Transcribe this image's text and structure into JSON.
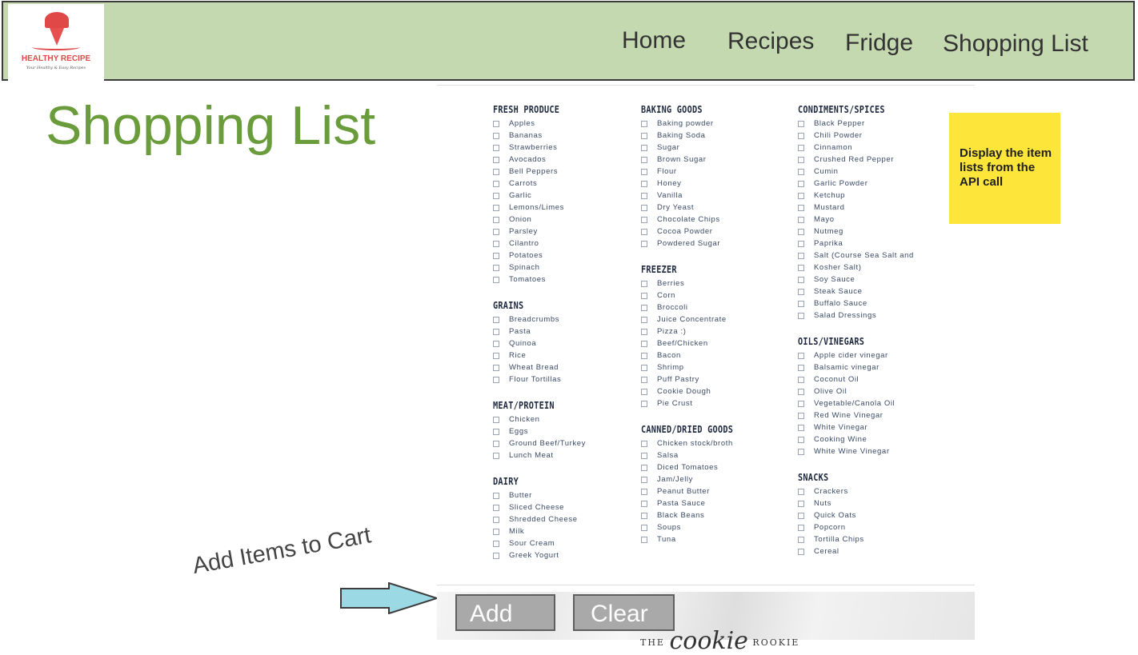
{
  "header": {
    "logo": {
      "brand": "HEALTHY RECIPE",
      "tagline": "Your Healthy & Easy Recipes"
    },
    "nav": [
      "Home",
      "Recipes",
      "Fridge",
      "Shopping List"
    ]
  },
  "page_title": "Shopping List",
  "note": "Display the item lists from the API call",
  "annotation": "Add Items to Cart",
  "buttons": {
    "add": "Add",
    "clear": "Clear"
  },
  "footer_brand": {
    "the": "THE",
    "script": "cookie",
    "rookie": "ROOKIE"
  },
  "columns": [
    [
      {
        "title": "FRESH PRODUCE",
        "items": [
          "Apples",
          "Bananas",
          "Strawberries",
          "Avocados",
          "Bell Peppers",
          "Carrots",
          "Garlic",
          "Lemons/Limes",
          "Onion",
          "Parsley",
          "Cilantro",
          "Potatoes",
          "Spinach",
          "Tomatoes"
        ]
      },
      {
        "title": "GRAINS",
        "items": [
          "Breadcrumbs",
          "Pasta",
          "Quinoa",
          "Rice",
          "Wheat Bread",
          "Flour Tortillas"
        ]
      },
      {
        "title": "MEAT/PROTEIN",
        "items": [
          "Chicken",
          "Eggs",
          "Ground Beef/Turkey",
          "Lunch Meat"
        ]
      },
      {
        "title": "DAIRY",
        "items": [
          "Butter",
          "Sliced Cheese",
          "Shredded Cheese",
          "Milk",
          "Sour Cream",
          "Greek Yogurt"
        ]
      }
    ],
    [
      {
        "title": "BAKING GOODS",
        "items": [
          "Baking powder",
          "Baking Soda",
          "Sugar",
          "Brown Sugar",
          "Flour",
          "Honey",
          "Vanilla",
          "Dry Yeast",
          "Chocolate Chips",
          "Cocoa Powder",
          "Powdered Sugar"
        ]
      },
      {
        "title": "FREEZER",
        "items": [
          "Berries",
          "Corn",
          "Broccoli",
          "Juice Concentrate",
          "Pizza :)",
          "Beef/Chicken",
          "Bacon",
          "Shrimp",
          "Puff Pastry",
          "Cookie Dough",
          "Pie Crust"
        ]
      },
      {
        "title": "CANNED/DRIED GOODS",
        "items": [
          "Chicken stock/broth",
          "Salsa",
          "Diced Tomatoes",
          "Jam/Jelly",
          "Peanut Butter",
          "Pasta Sauce",
          "Black Beans",
          "Soups",
          "Tuna"
        ]
      }
    ],
    [
      {
        "title": "CONDIMENTS/SPICES",
        "items": [
          "Black Pepper",
          "Chili Powder",
          "Cinnamon",
          "Crushed Red Pepper",
          "Cumin",
          "Garlic Powder",
          "Ketchup",
          "Mustard",
          "Mayo",
          "Nutmeg",
          "Paprika",
          "Salt (Course Sea Salt and",
          "Kosher Salt)",
          "Soy Sauce",
          "Steak Sauce",
          "Buffalo Sauce",
          "Salad Dressings"
        ]
      },
      {
        "title": "OILS/VINEGARS",
        "items": [
          "Apple cider vinegar",
          "Balsamic vinegar",
          "Coconut Oil",
          "Olive Oil",
          "Vegetable/Canola Oil",
          "Red Wine Vinegar",
          "White Vinegar",
          "Cooking Wine",
          "White Wine Vinegar"
        ]
      },
      {
        "title": "SNACKS",
        "items": [
          "Crackers",
          "Nuts",
          "Quick Oats",
          "Popcorn",
          "Tortilla Chips",
          "Cereal"
        ]
      }
    ]
  ]
}
